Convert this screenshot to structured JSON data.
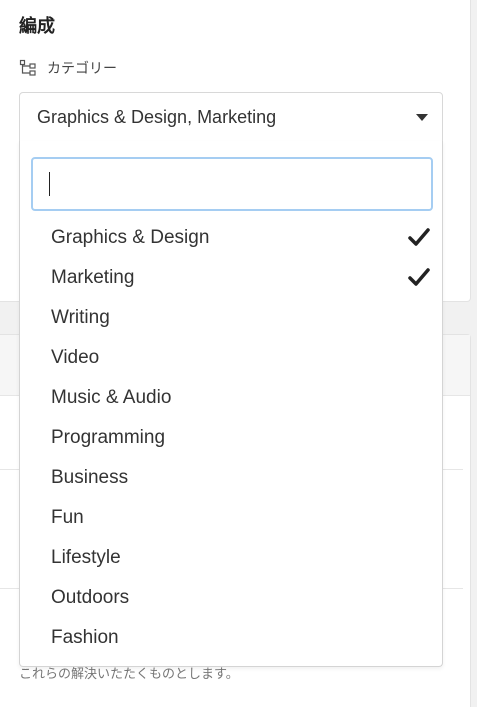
{
  "section": {
    "title": "編成"
  },
  "category_field": {
    "label": "カテゴリー",
    "icon": "category-tree-icon",
    "selected_value": "Graphics & Design, Marketing"
  },
  "dropdown": {
    "search_value": "",
    "options": [
      {
        "label": "Graphics & Design",
        "checked": true
      },
      {
        "label": "Marketing",
        "checked": true
      },
      {
        "label": "Writing",
        "checked": false
      },
      {
        "label": "Video",
        "checked": false
      },
      {
        "label": "Music & Audio",
        "checked": false
      },
      {
        "label": "Programming",
        "checked": false
      },
      {
        "label": "Business",
        "checked": false
      },
      {
        "label": "Fun",
        "checked": false
      },
      {
        "label": "Lifestyle",
        "checked": false
      },
      {
        "label": "Outdoors",
        "checked": false
      },
      {
        "label": "Fashion",
        "checked": false
      }
    ]
  },
  "footnote": "これらの解決いたたくものとします。",
  "colors": {
    "focus_border": "#a5cdf2",
    "accent": "#1a86c9"
  }
}
